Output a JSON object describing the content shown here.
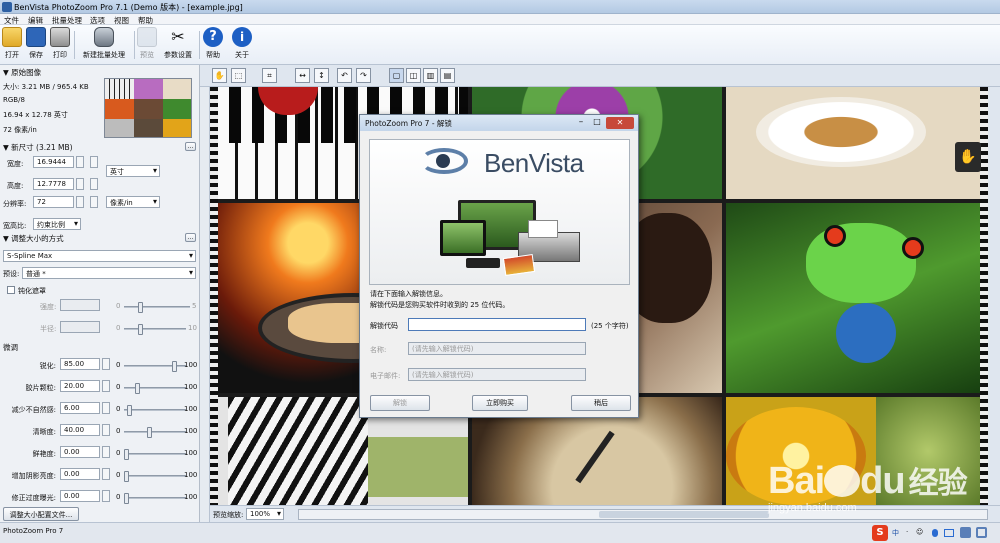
{
  "window": {
    "title": "BenVista PhotoZoom Pro 7.1 (Demo 版本) - [example.jpg]"
  },
  "menu": [
    "文件",
    "编辑",
    "批量处理",
    "选项",
    "视图",
    "帮助"
  ],
  "toolbar": {
    "open": "打开",
    "save": "保存",
    "print": "打印",
    "batch": "新建批量处理",
    "preview": "预览",
    "params": "参数设置",
    "help": "帮助",
    "about": "关于"
  },
  "original": {
    "header": "▼ 原始图像",
    "size": "大小: 3.21 MB / 965.4 KB",
    "mode": "RGB/8",
    "dims": "16.94 x 12.78 英寸",
    "res": "72 像素/in"
  },
  "newsize": {
    "header": "▼ 新尺寸 (3.21 MB)",
    "width_label": "宽度:",
    "width": "16.9444",
    "height_label": "高度:",
    "height": "12.7778",
    "res_label": "分辨率:",
    "res": "72",
    "unit": "英寸",
    "res_unit": "像素/in",
    "ratio_label": "宽高比:",
    "ratio": "约束比例"
  },
  "method": {
    "header": "▼ 调整大小的方式",
    "algo": "S-Spline Max",
    "preset_label": "预设:",
    "preset": "普通 *",
    "unsharp": "钝化遮罩",
    "strength_label": "强度:",
    "strength_min": "0",
    "strength_max": "5",
    "radius_label": "半径:",
    "radius_min": "0",
    "radius_max": "10"
  },
  "finetune": {
    "header": "微调",
    "rows": [
      {
        "label": "锐化:",
        "value": "85.00",
        "min": "0",
        "max": "100",
        "pos": 0.85
      },
      {
        "label": "胶片颗粒:",
        "value": "20.00",
        "min": "0",
        "max": "100",
        "pos": 0.2
      },
      {
        "label": "减少不自然感:",
        "value": "6.00",
        "min": "0",
        "max": "100",
        "pos": 0.06
      },
      {
        "label": "清晰度:",
        "value": "40.00",
        "min": "0",
        "max": "100",
        "pos": 0.4
      },
      {
        "label": "鲜艳度:",
        "value": "0.00",
        "min": "0",
        "max": "100",
        "pos": 0
      },
      {
        "label": "增加阴影亮度:",
        "value": "0.00",
        "min": "0",
        "max": "100",
        "pos": 0
      },
      {
        "label": "修正过度曝光:",
        "value": "0.00",
        "min": "0",
        "max": "100",
        "pos": 0
      }
    ]
  },
  "profile_button": "调整大小配置文件...",
  "preview_zoom": {
    "label": "预览缩放:",
    "value": "100%"
  },
  "status": {
    "text": "PhotoZoom Pro 7"
  },
  "dialog": {
    "title": "PhotoZoom Pro 7 - 解锁",
    "logo": "BenVista",
    "line1": "请在下面输入解锁信息。",
    "line2": "解锁代码是您购买软件时收到的 25 位代码。",
    "code_label": "解锁代码",
    "code_hint": "(25 个字符)",
    "name_label": "名称:",
    "name_placeholder": "(请先输入解锁代码)",
    "email_label": "电子邮件:",
    "email_placeholder": "(请先输入解锁代码)",
    "unlock": "解锁",
    "buy": "立即购买",
    "later": "稍后"
  },
  "watermark": {
    "brand": "Bai",
    "brand2": "du",
    "cn": "经验",
    "url": "jingyan.baidu.com"
  },
  "tray": [
    "中",
    "·",
    "☺"
  ]
}
